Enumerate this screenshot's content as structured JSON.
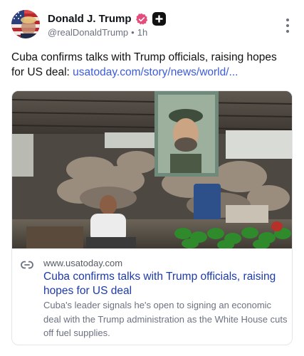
{
  "author": {
    "display_name": "Donald J. Trump",
    "handle": "@realDonaldTrump",
    "separator": "•",
    "time_ago": "1h",
    "verified_color": "#e44d7b",
    "avatar_icon": "flag-portrait-avatar"
  },
  "post": {
    "text": "Cuba confirms talks with Trump officials, raising hopes for US deal: ",
    "link_text": "usatoday.com/story/news/world/..."
  },
  "card": {
    "domain": "www.usatoday.com",
    "title": "Cuba confirms talks with Trump officials, raising hopes for US deal",
    "description": "Cuba's leader signals he's open to signing an economic deal with the Trump administration as the White House cuts off fuel supplies.",
    "link_icon": "link-chain-icon",
    "image_icon": "market-photo"
  },
  "colors": {
    "link": "#3b5bdb",
    "card_title": "#1c3aa9",
    "muted": "#6b7280"
  }
}
